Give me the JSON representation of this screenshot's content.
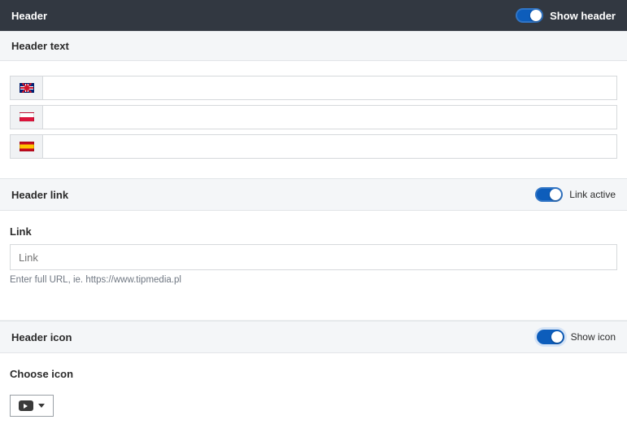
{
  "topbar": {
    "title": "Header",
    "toggle_label": "Show header"
  },
  "header_text": {
    "title": "Header text",
    "langs": [
      {
        "flag": "uk",
        "value": ""
      },
      {
        "flag": "pl",
        "value": ""
      },
      {
        "flag": "es",
        "value": ""
      }
    ]
  },
  "header_link": {
    "title": "Header link",
    "toggle_label": "Link active",
    "field_label": "Link",
    "placeholder": "Link",
    "helper": "Enter full URL, ie. https://www.tipmedia.pl"
  },
  "header_icon": {
    "title": "Header icon",
    "toggle_label": "Show icon",
    "field_label": "Choose icon"
  }
}
